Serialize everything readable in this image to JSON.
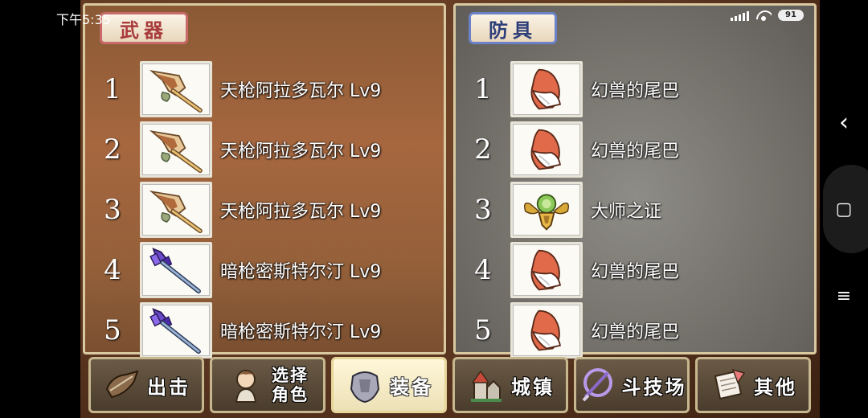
{
  "status_bar": {
    "time": "下午5:35",
    "battery": "91",
    "icons": [
      "signal-icon",
      "wifi-icon",
      "battery-icon"
    ]
  },
  "nav_bar": {
    "back": "‹",
    "home": "▢",
    "menu": "≡"
  },
  "weapons_panel": {
    "title": "武器",
    "items": [
      {
        "num": "1",
        "name": "天枪阿拉多瓦尔 Lv9",
        "icon": "golden-spear-icon"
      },
      {
        "num": "2",
        "name": "天枪阿拉多瓦尔 Lv9",
        "icon": "golden-spear-icon"
      },
      {
        "num": "3",
        "name": "天枪阿拉多瓦尔 Lv9",
        "icon": "golden-spear-icon"
      },
      {
        "num": "4",
        "name": "暗枪密斯特尔汀 Lv9",
        "icon": "dark-spear-icon"
      },
      {
        "num": "5",
        "name": "暗枪密斯特尔汀 Lv9",
        "icon": "dark-spear-icon"
      }
    ]
  },
  "armor_panel": {
    "title": "防具",
    "items": [
      {
        "num": "1",
        "name": "幻兽的尾巴",
        "icon": "beast-tail-icon"
      },
      {
        "num": "2",
        "name": "幻兽的尾巴",
        "icon": "beast-tail-icon"
      },
      {
        "num": "3",
        "name": "大师之证",
        "icon": "master-emblem-icon"
      },
      {
        "num": "4",
        "name": "幻兽的尾巴",
        "icon": "beast-tail-icon"
      },
      {
        "num": "5",
        "name": "幻兽的尾巴",
        "icon": "beast-tail-icon"
      }
    ]
  },
  "bottom_menu": {
    "sortie": "出击",
    "select_line1": "选择",
    "select_line2": "角色",
    "equip": "装备",
    "town": "城镇",
    "arena": "斗技场",
    "other": "其他",
    "active": "equip"
  },
  "colors": {
    "weapons_title": "#a83b3b",
    "armor_title": "#2e3e78",
    "panel_border": "#d9c9a0"
  }
}
